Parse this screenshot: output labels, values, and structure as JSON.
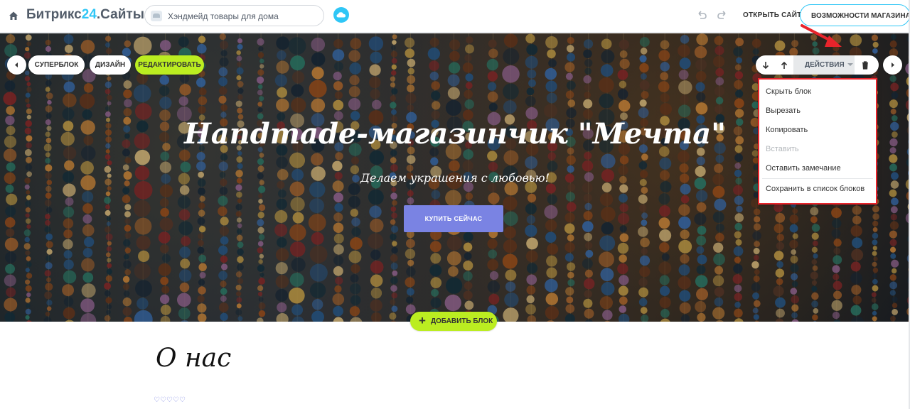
{
  "topbar": {
    "brand_main": "Битрикс",
    "brand_num": "24",
    "brand_suffix": ".Сайты",
    "site_name": "Хэндмейд товары для дома",
    "open_site": "ОТКРЫТЬ САЙТ",
    "shop_features": "ВОЗМОЖНОСТИ МАГАЗИНА",
    "icons": [
      "home-icon",
      "site-icon",
      "cloud-icon",
      "undo-icon",
      "redo-icon"
    ]
  },
  "block_toolbar": {
    "superblock": "СУПЕРБЛОК",
    "design": "ДИЗАЙН",
    "edit": "РЕДАКТИРОВАТЬ",
    "actions": "ДЕЙСТВИЯ"
  },
  "actions_menu": {
    "items": [
      {
        "label": "Скрыть блок",
        "disabled": false
      },
      {
        "label": "Вырезать",
        "disabled": false
      },
      {
        "label": "Копировать",
        "disabled": false
      },
      {
        "label": "Вставить",
        "disabled": true
      },
      {
        "label": "Оставить замечание",
        "disabled": false
      },
      {
        "label": "Сохранить в список блоков",
        "disabled": false
      }
    ]
  },
  "hero": {
    "title": "Handmade-магазинчик \"Мечта\"",
    "subtitle": "Делаем украшения с любовью!",
    "buy_button": "КУПИТЬ СЕЙЧАС"
  },
  "add_block": "ДОБАВИТЬ БЛОК",
  "about": {
    "title": "О нас",
    "hearts": "♡♡♡♡♡"
  },
  "colors": {
    "accent_blue": "#2fc6f6",
    "green": "#bbed21",
    "button_purple": "#7a83e3",
    "highlight_red": "#e8242b"
  }
}
